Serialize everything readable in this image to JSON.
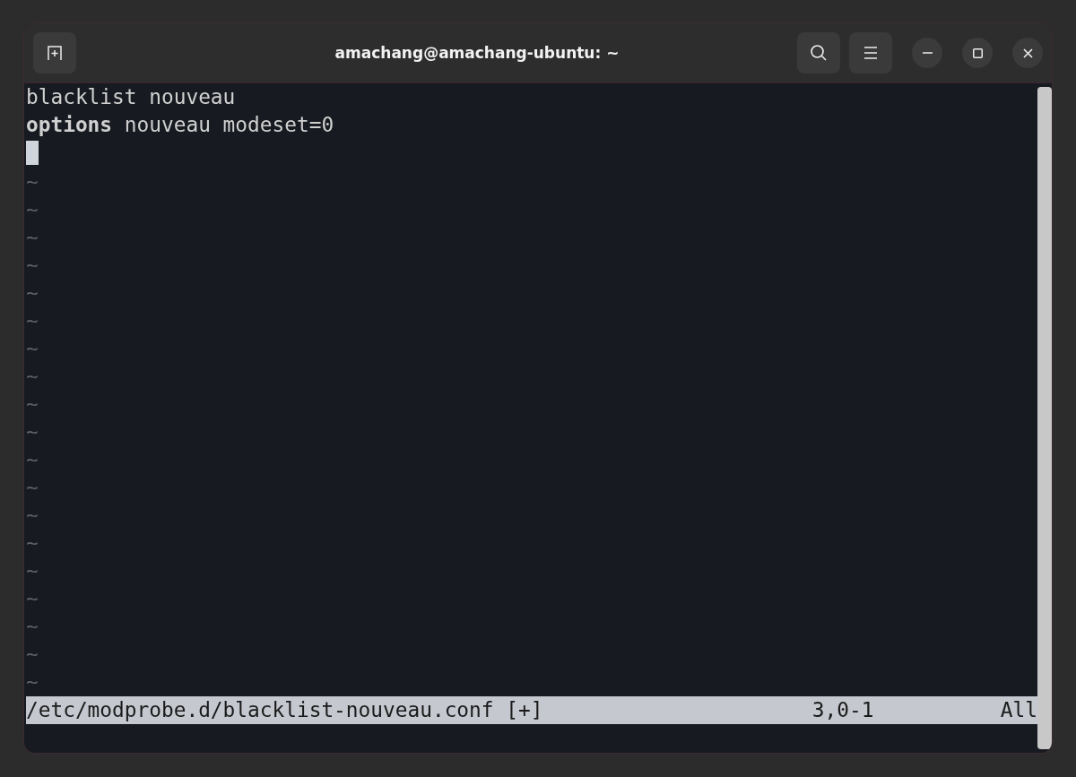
{
  "window": {
    "title": "amachang@amachang-ubuntu: ~"
  },
  "editor": {
    "lines": [
      "blacklist nouveau",
      "**options** nouveau modeset=0"
    ],
    "tilde_lines": [
      "~",
      "~",
      "~",
      "~",
      "~",
      "~",
      "~",
      "~",
      "~",
      "~",
      "~",
      "~",
      "~",
      "~",
      "~",
      "~",
      "~",
      "~",
      "~"
    ],
    "status_bar": {
      "file": "/etc/modprobe.d/blacklist-nouveau.conf [+]",
      "position": "3,0-1",
      "scroll": "All"
    }
  }
}
